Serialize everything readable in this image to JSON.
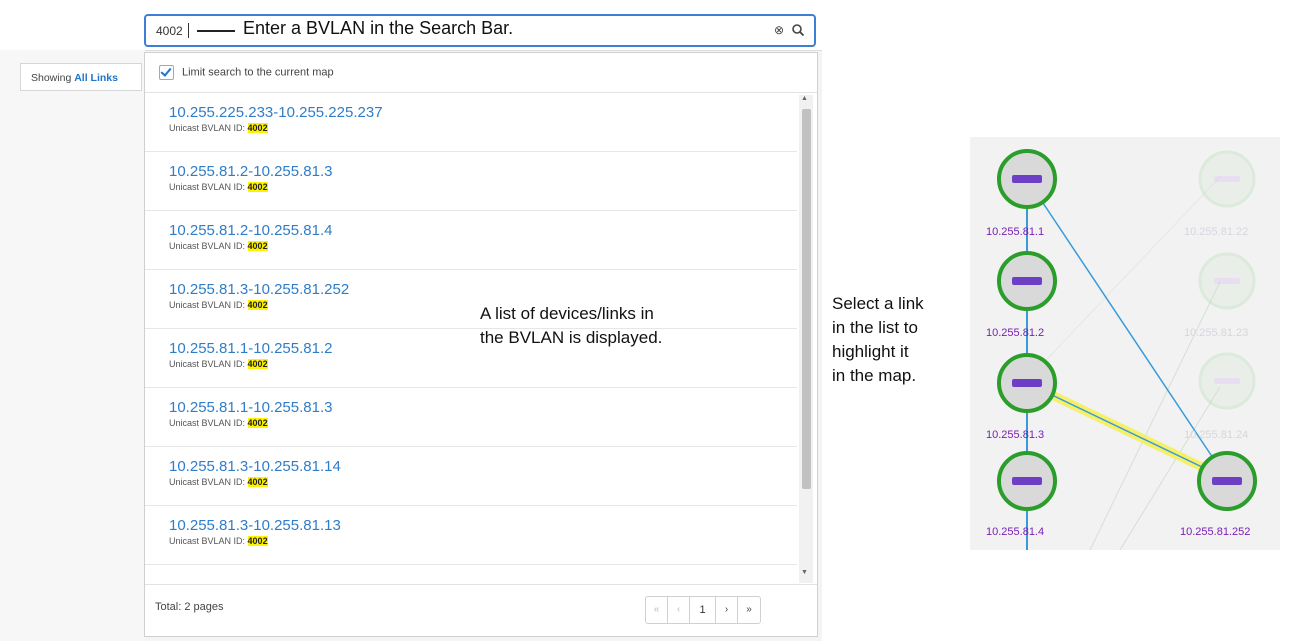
{
  "app": {
    "showing_prefix": "Showing",
    "showing_link": "All Links"
  },
  "search": {
    "value": "4002",
    "annotation": "Enter a BVLAN in the Search Bar."
  },
  "dropdown": {
    "limit_label": "Limit search to the current map",
    "limit_checked": true,
    "sub_prefix": "Unicast BVLAN ID:",
    "highlight": "4002",
    "results": [
      {
        "title": "10.255.225.233-10.255.225.237"
      },
      {
        "title": "10.255.81.2-10.255.81.3"
      },
      {
        "title": "10.255.81.2-10.255.81.4"
      },
      {
        "title": "10.255.81.3-10.255.81.252"
      },
      {
        "title": "10.255.81.1-10.255.81.2"
      },
      {
        "title": "10.255.81.1-10.255.81.3"
      },
      {
        "title": "10.255.81.3-10.255.81.14"
      },
      {
        "title": "10.255.81.3-10.255.81.13"
      }
    ],
    "total": "Total: 2 pages",
    "pager": {
      "first": "«",
      "prev": "‹",
      "page": "1",
      "next": "›",
      "last": "»"
    }
  },
  "annotations": {
    "list_line1": "A list of devices/links in",
    "list_line2": "the BVLAN is displayed.",
    "select_line1": "Select a link",
    "select_line2": "in the list to",
    "select_line3": "highlight it",
    "select_line4": "in the map."
  },
  "map": {
    "node_color": "#2a9d2a",
    "link_color": "#3a9ad9",
    "highlight_color": "#f4f06a",
    "label_color": "#7a1fb6",
    "nodes": [
      {
        "label": "10.255.81.1",
        "faded": false
      },
      {
        "label": "10.255.81.2",
        "faded": false
      },
      {
        "label": "10.255.81.3",
        "faded": false
      },
      {
        "label": "10.255.81.4",
        "faded": false
      },
      {
        "label": "10.255.81.252",
        "faded": false
      },
      {
        "label": "10.255.81.22",
        "faded": true
      },
      {
        "label": "10.255.81.23",
        "faded": true
      },
      {
        "label": "10.255.81.24",
        "faded": true
      }
    ]
  }
}
